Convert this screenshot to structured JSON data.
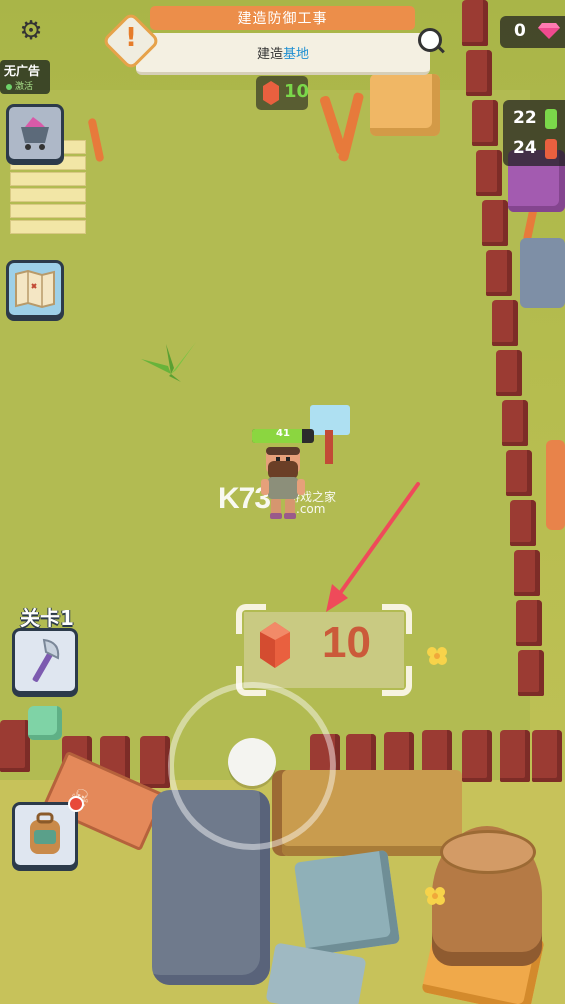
{
  "hud": {
    "top_banner": "建造防御工事",
    "quest_text_prefix": "建造",
    "quest_text_highlight": "基地",
    "settings_icon": "gear-icon",
    "no_ads_label": "无广告",
    "no_ads_status": "激活"
  },
  "resources": {
    "gems": "0",
    "green_potion": "22",
    "red_potion": "24",
    "quest_cost": "10"
  },
  "player": {
    "hp": "41",
    "hp_fraction": 0.8
  },
  "build_plot": {
    "cost": "10"
  },
  "level": {
    "label": "关卡1"
  },
  "watermark": {
    "logo": "K73",
    "site": "游戏之家",
    "domain": ".com"
  },
  "colors": {
    "accent_orange": "#ec8e4a",
    "quest_highlight": "#1e8fd2",
    "hp_bar": "#8bd640",
    "fence": "#9b3b33",
    "cost_text": "#cb5a3a"
  }
}
